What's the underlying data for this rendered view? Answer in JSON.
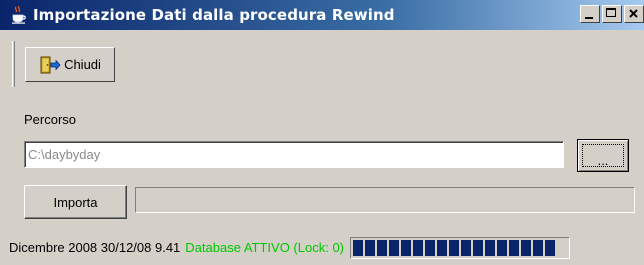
{
  "window": {
    "title": "Importazione Dati dalla procedura Rewind",
    "app_icon": "java-cup-icon",
    "controls": [
      "minimize",
      "maximize",
      "close"
    ]
  },
  "toolbar": {
    "close_label": "Chiudi",
    "close_icon": "exit-door-icon"
  },
  "form": {
    "path_label": "Percorso",
    "path_value": "C:\\daybyday",
    "browse_label": "...",
    "import_label": "Importa",
    "import_progress": 0
  },
  "status": {
    "date_text": "Dicembre 2008 30/12/08 9.41",
    "db_status_text": "Database ATTIVO (Lock: 0)",
    "db_status_color": "#00c800",
    "db_activity_blocks": 17,
    "accent": "#0a246a"
  }
}
